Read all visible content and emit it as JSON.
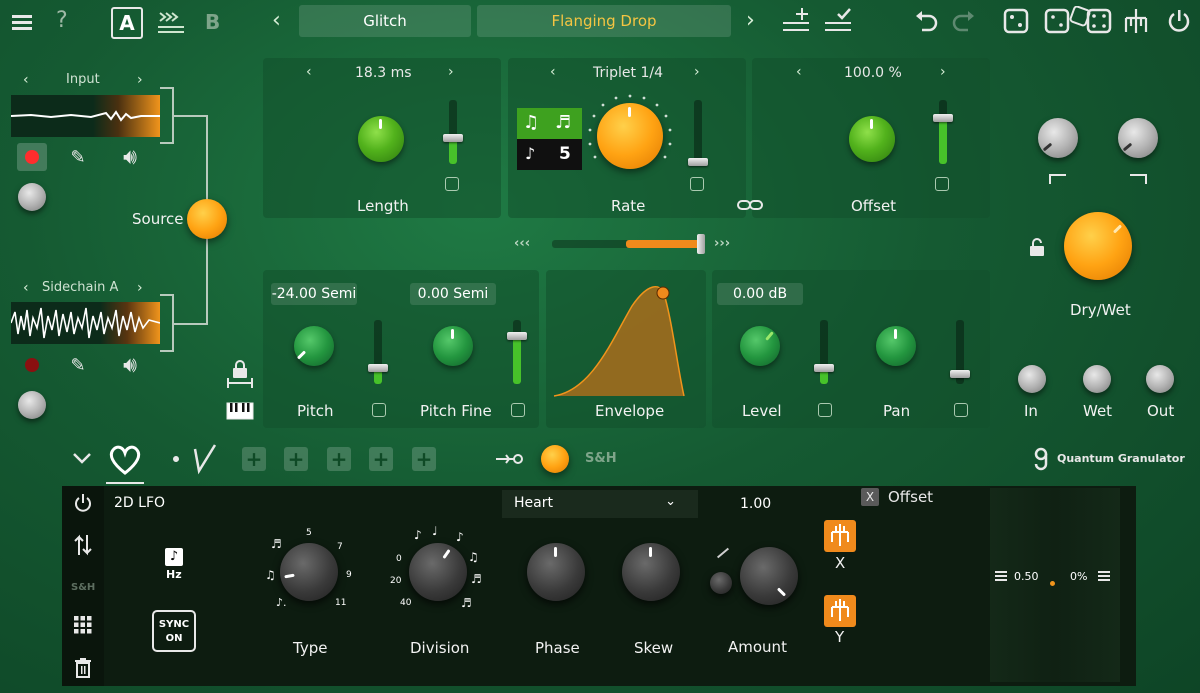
{
  "topbar": {
    "help": "?",
    "preset_a": "A",
    "preset_b": "B",
    "preset_prev": "‹",
    "preset_next": "›",
    "bank": "Glitch",
    "preset": "Flanging Drop"
  },
  "source": {
    "input_label": "Input",
    "sidechain_label": "Sidechain A",
    "source_label": "Source",
    "prev": "‹",
    "next": "›"
  },
  "length": {
    "value": "18.3 ms",
    "label": "Length"
  },
  "rate": {
    "value": "Triplet 1/4",
    "label": "Rate",
    "division_number": "5",
    "note_a": "♫",
    "note_b": "♬",
    "note_c": "♪"
  },
  "offset": {
    "value": "100.0 %",
    "label": "Offset"
  },
  "pitch": {
    "value": "-24.00 Semi",
    "label": "Pitch"
  },
  "pitch_fine": {
    "value": "0.00 Semi",
    "label": "Pitch Fine"
  },
  "envelope": {
    "label": "Envelope"
  },
  "level": {
    "value": "0.00 dB",
    "label": "Level"
  },
  "pan": {
    "label": "Pan"
  },
  "drywet": {
    "label": "Dry/Wet"
  },
  "io": {
    "in": "In",
    "wet": "Wet",
    "out": "Out"
  },
  "modtabs": {
    "sh": "S&H",
    "brand": "Quantum Granulator"
  },
  "lfo": {
    "title": "2D LFO",
    "shape": "Heart",
    "amount_value": "1.00",
    "hz": "Hz",
    "sync_line1": "SYNC",
    "sync_line2": "ON",
    "sh_side": "S&H",
    "type_label": "Type",
    "division_label": "Division",
    "phase_label": "Phase",
    "skew_label": "Skew",
    "amount_label": "Amount",
    "x_label": "X",
    "y_label": "Y",
    "target_close": "X",
    "target": "Offset",
    "target_value": "0.50",
    "target_pct": "0%",
    "type_ticks": [
      "5",
      "7",
      "9",
      "11"
    ],
    "division_ticks": [
      "0",
      "20",
      "40"
    ]
  },
  "colors": {
    "accent_orange": "#ffa313",
    "preset_text": "#f5c542",
    "bg_green": "#155a32"
  }
}
